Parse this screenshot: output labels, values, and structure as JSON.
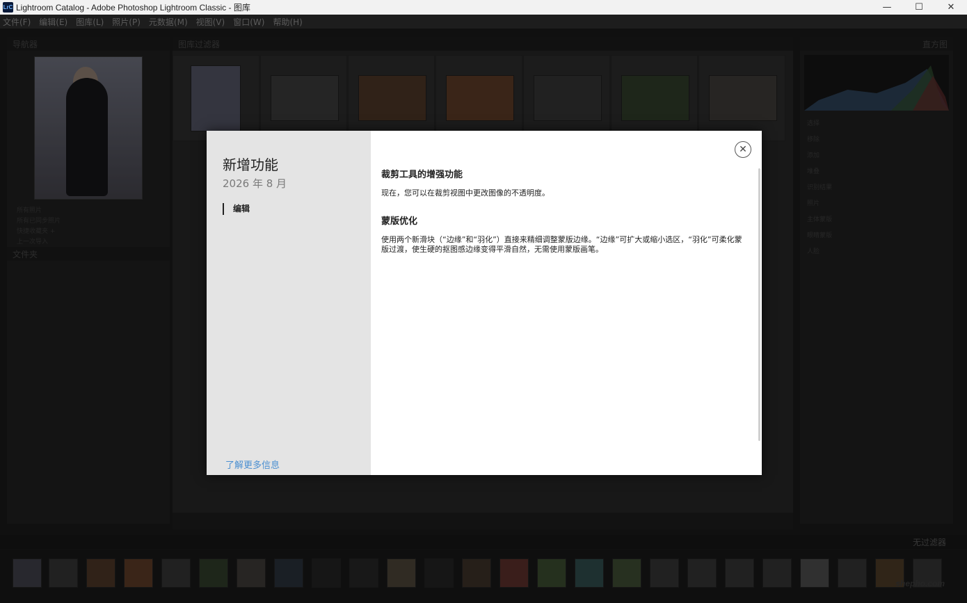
{
  "window": {
    "app_badge": "LrC",
    "title": "Lightroom Catalog - Adobe Photoshop Lightroom Classic - 图库",
    "minimize": "—",
    "maximize": "☐",
    "close": "✕"
  },
  "menu": {
    "items": [
      "文件(F)",
      "编辑(E)",
      "图库(L)",
      "照片(P)",
      "元数据(M)",
      "视图(V)",
      "窗口(W)",
      "帮助(H)"
    ]
  },
  "background": {
    "navigator_label": "导航器",
    "grid_header": "图库过滤器",
    "histogram_label": "直方图",
    "filter_label": "无过滤器",
    "left_rows": [
      "所有照片",
      "所有已同步照片",
      "快捷收藏夹 +",
      "上一次导入"
    ],
    "folders_label": "文件夹",
    "right_rows": [
      "选择",
      "移除",
      "添加",
      "堆叠",
      "识别结果",
      "照片",
      "主体蒙版",
      "眼睛蒙版",
      "人脸"
    ],
    "watermark": "shepho.com"
  },
  "dialog": {
    "title": "新增功能",
    "date": "2026 年 8 月",
    "nav_item": "编辑",
    "learn_more": "了解更多信息",
    "close_symbol": "✕",
    "sections": [
      {
        "heading": "裁剪工具的增强功能",
        "body": "现在，您可以在裁剪视图中更改图像的不透明度。"
      },
      {
        "heading": "蒙版优化",
        "body": "使用两个新滑块（“边缘”和“羽化”）直接来精细调整蒙版边缘。“边缘”可扩大或缩小选区，“羽化”可柔化蒙版过渡，使生硬的抠图感边缘变得平滑自然，无需使用蒙版画笔。"
      }
    ]
  }
}
